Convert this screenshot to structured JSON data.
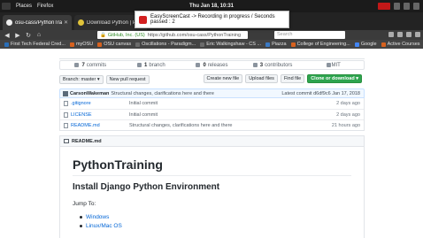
{
  "topbar": {
    "places": "Places",
    "firefox": "Firefox",
    "clock": "Thu Jan 18, 10:31"
  },
  "tabs": [
    {
      "title": "osu-cass/PythonTraining",
      "favicon_color": "#222222"
    },
    {
      "title": "Download Python | Python",
      "favicon_color": "#e0c33a"
    }
  ],
  "notification": {
    "text": "EasyScreenCast -> Recording in progress / Seconds passed : 2"
  },
  "nav": {
    "org": "GitHub, Inc. (US)",
    "url": "https://github.com/osu-cass/PythonTraining",
    "search_placeholder": "Search"
  },
  "bookmarks": [
    {
      "label": "First Tech Federal Cred...",
      "color": "#2a6fb8"
    },
    {
      "label": "myOSU",
      "color": "#d7621f"
    },
    {
      "label": "OSU canvas",
      "color": "#d7621f"
    },
    {
      "label": "Oscillations - Paradigm...",
      "color": "#6b6b6b"
    },
    {
      "label": "Eric Walkingshaw - CS ...",
      "color": "#6b6b6b"
    },
    {
      "label": "Piazza",
      "color": "#3a79c4"
    },
    {
      "label": "College of Engineering...",
      "color": "#d7621f"
    },
    {
      "label": "Google",
      "color": "#4285f4"
    },
    {
      "label": "Active Courses",
      "color": "#d7621f"
    }
  ],
  "repo": {
    "summary": [
      {
        "count": "7",
        "label": "commits"
      },
      {
        "count": "1",
        "label": "branch"
      },
      {
        "count": "0",
        "label": "releases"
      },
      {
        "count": "3",
        "label": "contributors"
      },
      {
        "count": "",
        "label": "MIT"
      }
    ],
    "branch_button": "Branch: master ▾",
    "new_pr_button": "New pull request",
    "create_file": "Create new file",
    "upload_files": "Upload files",
    "find_file": "Find file",
    "clone_button": "Clone or download ▾",
    "commit": {
      "author": "CarsonWakeman",
      "message": "Structural changes, clarifications here and there",
      "latest": "Latest commit d6df9c6 Jan 17, 2018"
    },
    "files": [
      {
        "name": ".gitignore",
        "message": "Initial commit",
        "age": "2 days ago"
      },
      {
        "name": "LICENSE",
        "message": "Initial commit",
        "age": "2 days ago"
      },
      {
        "name": "README.md",
        "message": "Structural changes, clarifications here and there",
        "age": "21 hours ago"
      }
    ],
    "readme": {
      "header": "README.md",
      "title": "PythonTraining",
      "subtitle": "Install Django Python Environment",
      "jump_to": "Jump To:",
      "links": [
        "Windows",
        "Linux/Mac OS"
      ]
    }
  }
}
